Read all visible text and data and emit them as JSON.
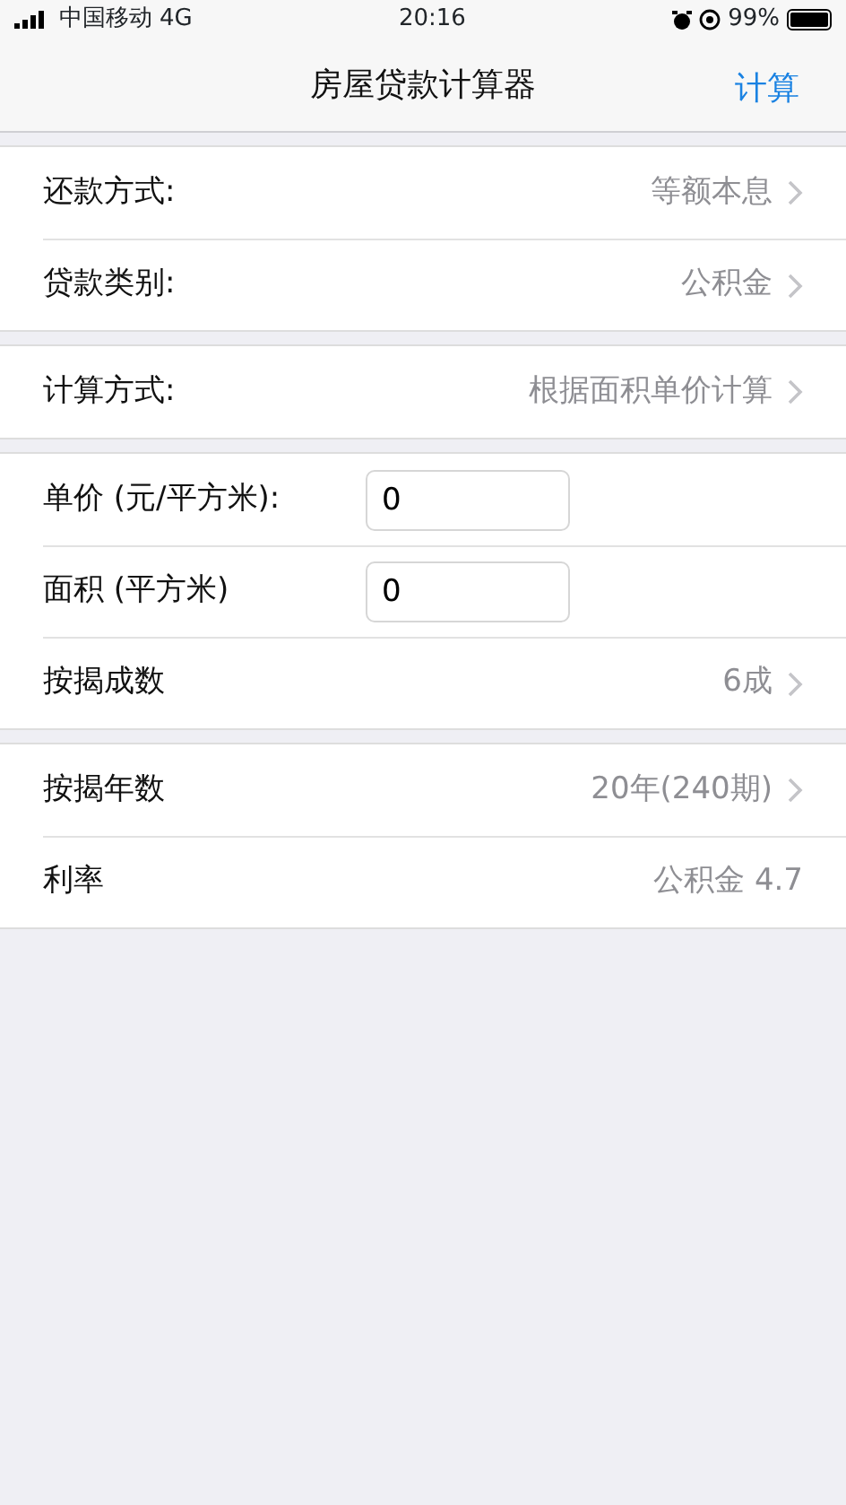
{
  "status_bar": {
    "carrier": "中国移动",
    "network": "4G",
    "time": "20:16",
    "battery": "99%"
  },
  "nav": {
    "title": "房屋贷款计算器",
    "action": "计算"
  },
  "groups": [
    {
      "rows": [
        {
          "kind": "select",
          "label": "还款方式:",
          "value": "等额本息"
        },
        {
          "kind": "select",
          "label": "贷款类别:",
          "value": "公积金"
        }
      ]
    },
    {
      "rows": [
        {
          "kind": "select",
          "label": "计算方式:",
          "value": "根据面积单价计算"
        }
      ]
    },
    {
      "rows": [
        {
          "kind": "input",
          "label": "单价 (元/平方米):",
          "value": "0"
        },
        {
          "kind": "input",
          "label": "面积 (平方米)",
          "value": "0"
        },
        {
          "kind": "select",
          "label": "按揭成数",
          "value": "6成"
        }
      ]
    },
    {
      "rows": [
        {
          "kind": "select",
          "label": "按揭年数",
          "value": "20年(240期)"
        },
        {
          "kind": "info",
          "label": "利率",
          "value": "公积金 4.7"
        }
      ]
    }
  ]
}
